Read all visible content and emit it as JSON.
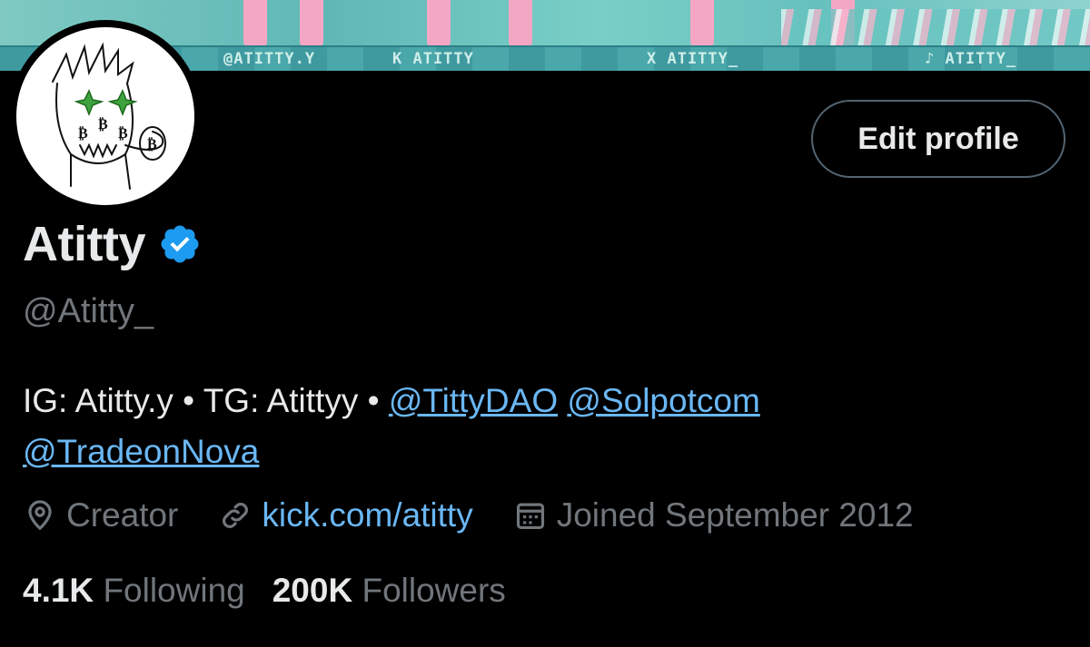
{
  "banner": {
    "tags": [
      "@ATITTY.Y",
      "K ATITTY",
      "X ATITTY_",
      "♪ ATITTY_"
    ]
  },
  "profile": {
    "display_name": "Atitty",
    "handle": "@Atitty_",
    "edit_label": "Edit profile",
    "bio": {
      "plain_1": "IG: Atitty.y • TG: Atittyy • ",
      "mention_1": "@TittyDAO",
      "mention_2": "@Solpotcom",
      "mention_3": "@TradeonNova"
    },
    "category": "Creator",
    "website": "kick.com/atitty",
    "joined": "Joined September 2012"
  },
  "stats": {
    "following_count": "4.1K",
    "following_label": "Following",
    "followers_count": "200K",
    "followers_label": "Followers"
  },
  "colors": {
    "background": "#000000",
    "text_primary": "#e7e9ea",
    "text_secondary": "#71767b",
    "link": "#6ab7f4",
    "verified": "#1d9bf0"
  }
}
